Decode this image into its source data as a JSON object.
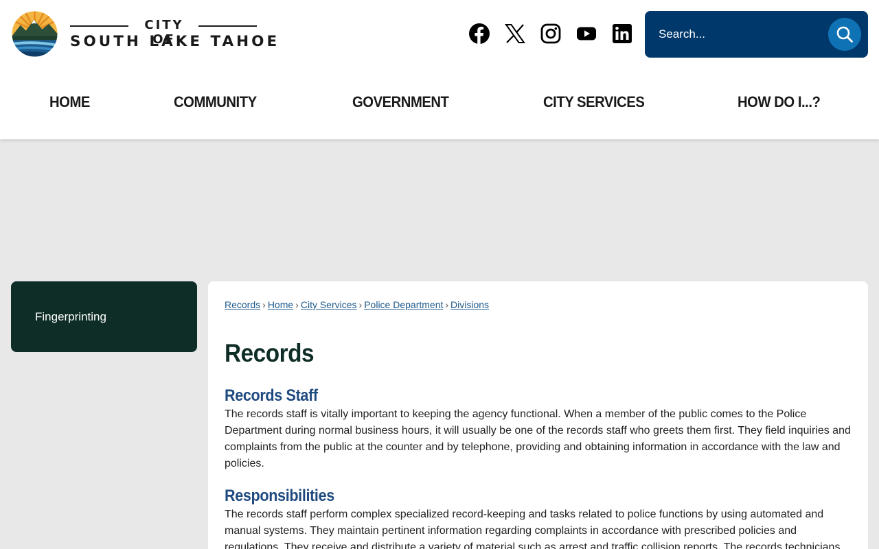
{
  "site": {
    "logo_top": "CITY OF",
    "logo_name": "SOUTH LAKE TAHOE"
  },
  "social": [
    {
      "name": "facebook-icon"
    },
    {
      "name": "x-icon"
    },
    {
      "name": "instagram-icon"
    },
    {
      "name": "youtube-icon"
    },
    {
      "name": "linkedin-icon"
    }
  ],
  "search": {
    "placeholder": "Search..."
  },
  "nav": {
    "items": [
      "HOME",
      "COMMUNITY",
      "GOVERNMENT",
      "CITY SERVICES",
      "HOW DO I...?"
    ]
  },
  "sidebar": {
    "items": [
      {
        "label": "Fingerprinting"
      }
    ]
  },
  "breadcrumb": [
    "Records",
    "Home",
    "City Services",
    "Police Department",
    "Divisions"
  ],
  "page": {
    "title": "Records",
    "sections": [
      {
        "heading": "Records Staff",
        "text": "The records staff is vitally important to keeping the agency functional. When a member of the public comes to the Police Department during normal business hours, it will usually be one of the records staff who greets them first. They field inquiries and complaints from the public at the counter and by telephone, providing and obtaining information in accordance with the law and policies."
      },
      {
        "heading": "Responsibilities",
        "text": "The records staff perform complex specialized record-keeping and tasks related to police functions by using automated and manual systems. They maintain pertinent information regarding complaints in accordance with prescribed policies and regulations. They receive and distribute a variety of material such as arrest and traffic collision reports. The records technicians"
      }
    ]
  },
  "colors": {
    "header_bg": "#ffffff",
    "page_bg": "#e8e8e8",
    "search_bg": "#00386b",
    "search_button": "#0f72b5",
    "sidebar_bg": "#0e2d26",
    "heading": "#1f4a80",
    "title": "#0e2d26",
    "link": "#1f5a8c"
  }
}
